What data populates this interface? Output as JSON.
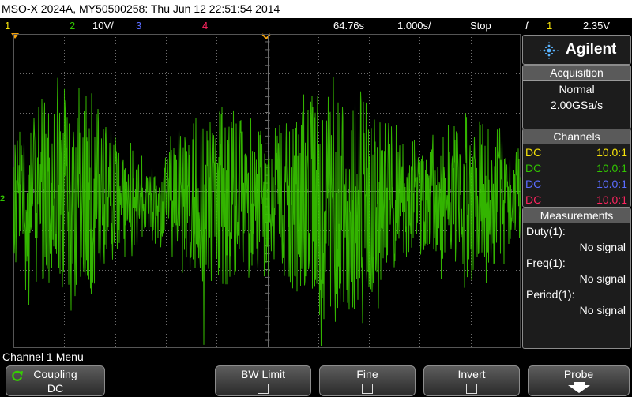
{
  "title": "MSO-X 2024A, MY50500258: Thu Jun 12 22:51:54 2014",
  "status": {
    "ch1_num": "1",
    "ch2_num": "2",
    "ch2_scale": "10V/",
    "ch3_num": "3",
    "ch4_num": "4",
    "time_delay": "64.76s",
    "time_scale": "1.000s/",
    "run_state": "Stop",
    "trigger_symbol": "f",
    "trigger_source": "1",
    "trigger_level": "2.35V"
  },
  "colors": {
    "ch1": "#f7e40a",
    "ch2": "#31c400",
    "ch3": "#5a6cff",
    "ch4": "#ff2560",
    "trace": "#38c800",
    "grid": "#6e6e6e",
    "trigger_marker": "#f3a20d"
  },
  "screen": {
    "channel_marker": "2"
  },
  "logo": {
    "brand": "Agilent"
  },
  "acquisition": {
    "header": "Acquisition",
    "mode": "Normal",
    "rate": "2.00GSa/s"
  },
  "channels": {
    "header": "Channels",
    "rows": [
      {
        "coupling": "DC",
        "probe": "10.0:1",
        "color": "#f7e40a"
      },
      {
        "coupling": "DC",
        "probe": "10.0:1",
        "color": "#31c400"
      },
      {
        "coupling": "DC",
        "probe": "10.0:1",
        "color": "#5a6cff"
      },
      {
        "coupling": "DC",
        "probe": "10.0:1",
        "color": "#ff2560"
      }
    ]
  },
  "measurements": {
    "header": "Measurements",
    "items": [
      {
        "label": "Duty(1):",
        "value": "No signal"
      },
      {
        "label": "Freq(1):",
        "value": "No signal"
      },
      {
        "label": "Period(1):",
        "value": "No signal"
      }
    ]
  },
  "menu": {
    "title": "Channel 1 Menu",
    "softkeys": {
      "coupling": {
        "label": "Coupling",
        "value": "DC"
      },
      "bw_limit": {
        "label": "BW Limit"
      },
      "fine": {
        "label": "Fine"
      },
      "invert": {
        "label": "Invert"
      },
      "probe": {
        "label": "Probe"
      }
    }
  }
}
